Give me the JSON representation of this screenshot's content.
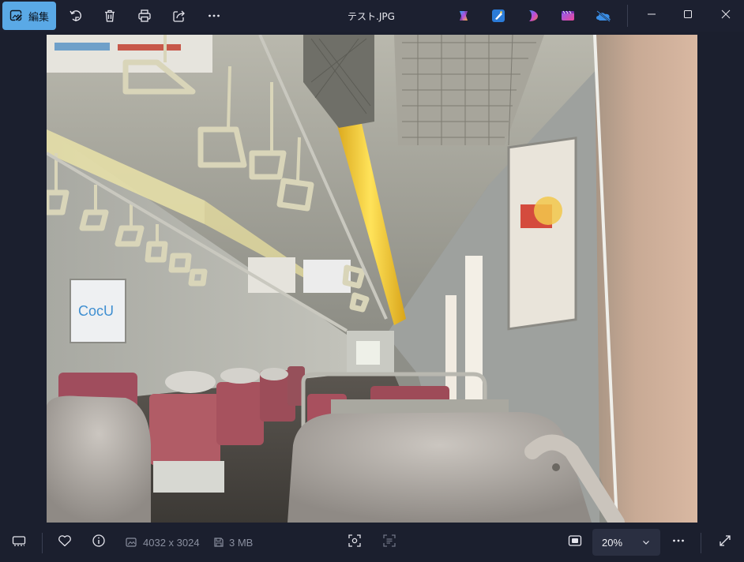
{
  "window": {
    "title": "テスト.JPG"
  },
  "toolbar": {
    "edit_label": "編集",
    "edit_icon": "edit-image-icon",
    "buttons": [
      "rotate-icon",
      "delete-icon",
      "print-icon",
      "share-icon",
      "more-icon"
    ],
    "apps": [
      "copilot-icon",
      "paint-icon",
      "clipchamp-icon",
      "video-editor-icon",
      "onedrive-icon"
    ]
  },
  "colors": {
    "accent": "#5aa9e6",
    "background": "#1b1f2e",
    "toolbar": "#1c2030"
  },
  "status": {
    "dimensions": "4032 x 3024",
    "file_size": "3 MB",
    "zoom": "20%"
  },
  "bottom": {
    "icons": [
      "filmstrip-icon",
      "favorite-icon",
      "info-icon",
      "image-size-icon",
      "file-size-icon",
      "visual-search-icon",
      "text-scan-icon",
      "fit-to-window-icon",
      "more-icon",
      "fullscreen-icon"
    ]
  },
  "photo": {
    "description_icon": "photo-train-interior"
  }
}
